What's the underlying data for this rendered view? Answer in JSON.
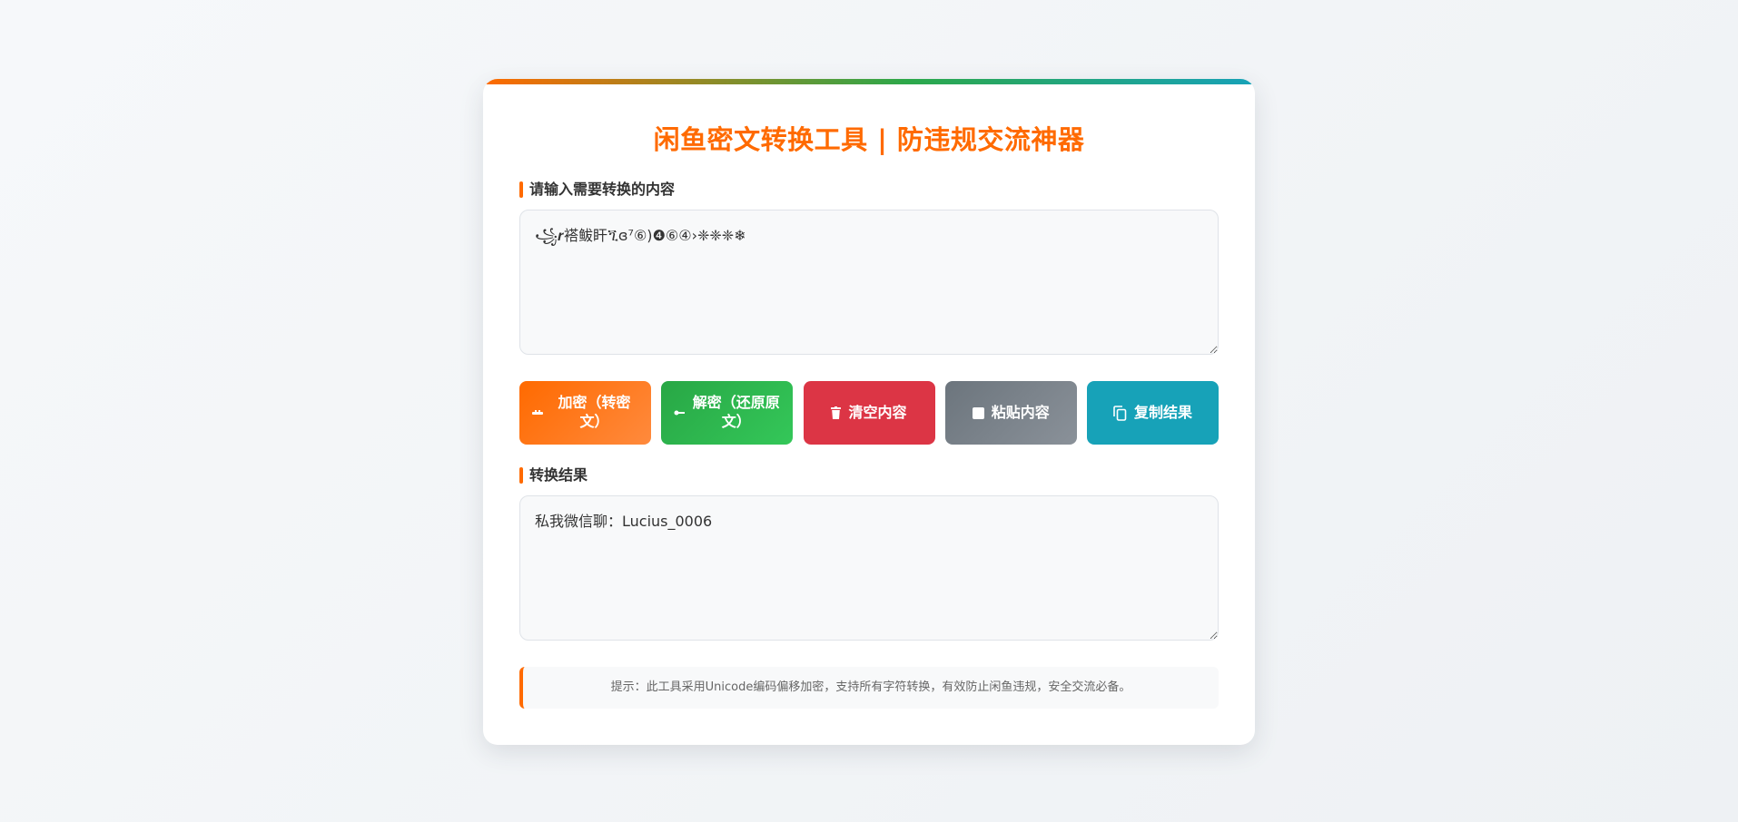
{
  "title": "闲鱼密文转换工具 | 防违规交流神器",
  "input_section": {
    "label": "请输入需要转换的内容",
    "value": "꧁𝒓褡鲅盰ጚɞ⁷⑥)❹⑥④›❈❈❈❄"
  },
  "buttons": {
    "encrypt": {
      "label": "加密（转密文）",
      "icon": "lock-icon"
    },
    "decrypt": {
      "label": "解密（还原原文）",
      "icon": "key-icon"
    },
    "clear": {
      "label": "清空内容",
      "icon": "trash-icon"
    },
    "paste": {
      "label": "粘贴内容",
      "icon": "clipboard-icon"
    },
    "copy": {
      "label": "复制结果",
      "icon": "copy-icon"
    }
  },
  "output_section": {
    "label": "转换结果",
    "value": "私我微信聊：Lucius_0006"
  },
  "hint": "提示：此工具采用Unicode编码偏移加密，支持所有字符转换，有效防止闲鱼违规，安全交流必备。",
  "colors": {
    "accent": "#ff6a00",
    "encrypt": "#ff6a00",
    "decrypt": "#28a745",
    "clear": "#dc3545",
    "paste": "#6c757d",
    "copy": "#17a2b8"
  }
}
